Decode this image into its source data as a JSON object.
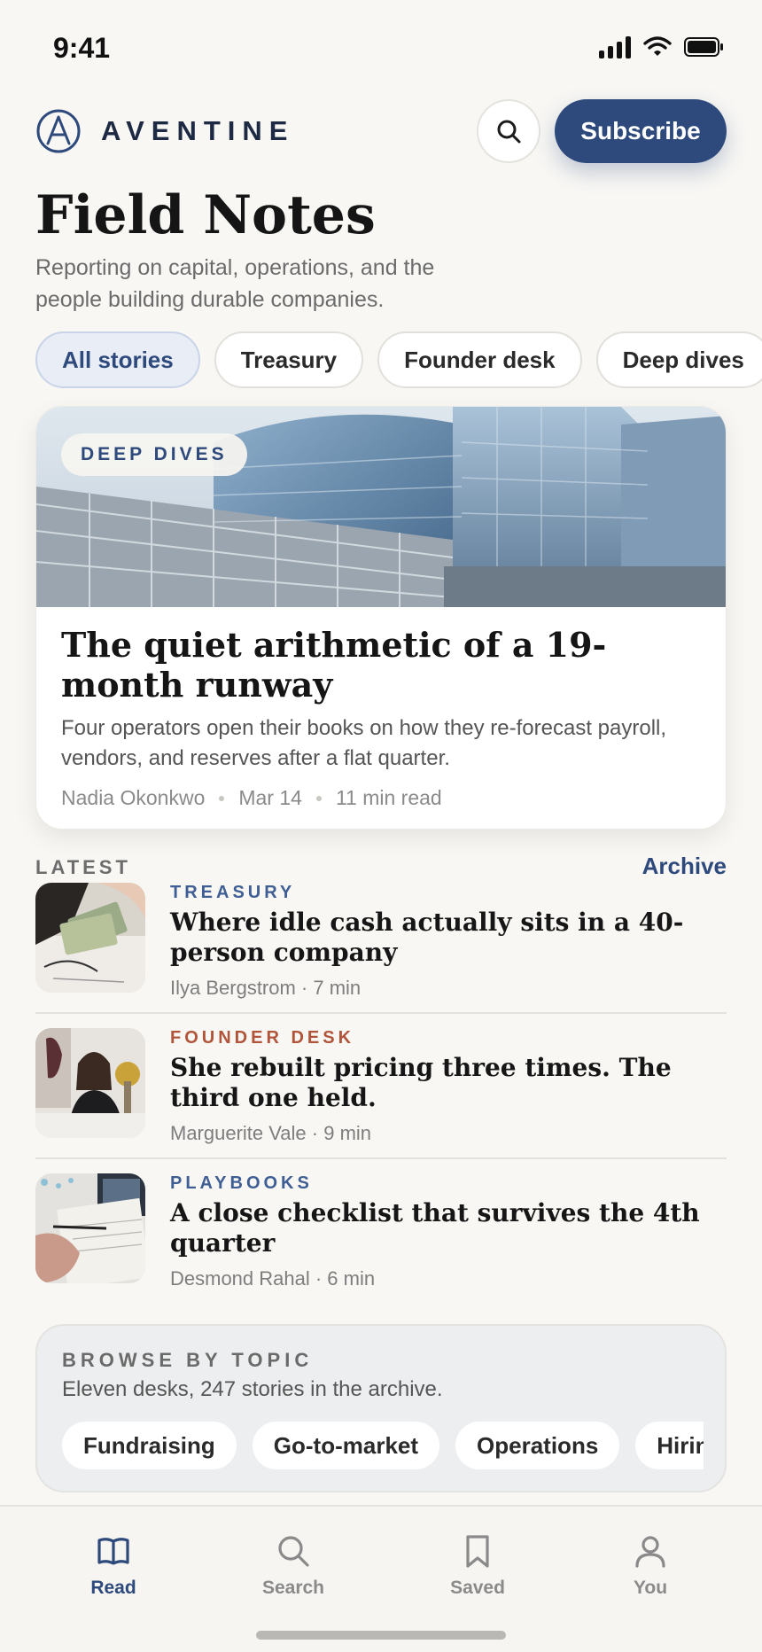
{
  "status_bar": {
    "time": "9:41"
  },
  "header": {
    "brand": "AVENTINE",
    "subscribe_label": "Subscribe"
  },
  "page": {
    "title": "Field Notes",
    "subtitle": "Reporting on capital, operations, and the people building durable companies."
  },
  "filters": [
    {
      "label": "All stories",
      "active": true
    },
    {
      "label": "Treasury",
      "active": false
    },
    {
      "label": "Founder desk",
      "active": false
    },
    {
      "label": "Deep dives",
      "active": false
    }
  ],
  "featured": {
    "badge": "DEEP DIVES",
    "title": "The quiet arithmetic of a 19-month runway",
    "dek": "Four operators open their books on how they re-forecast payroll, vendors, and reserves after a flat quarter.",
    "author": "Nadia Okonkwo",
    "date": "Mar 14",
    "read_time": "11 min read"
  },
  "latest": {
    "label": "LATEST",
    "archive_label": "Archive",
    "items": [
      {
        "kicker": "TREASURY",
        "kicker_color": "#3f5f94",
        "title": "Where idle cash actually sits in a 40-person company",
        "meta": "Ilya Bergstrom · 7 min"
      },
      {
        "kicker": "FOUNDER DESK",
        "kicker_color": "#b0553a",
        "title": "She rebuilt pricing three times. The third one held.",
        "meta": "Marguerite Vale · 9 min"
      },
      {
        "kicker": "PLAYBOOKS",
        "kicker_color": "#3f5f94",
        "title": "A close checklist that survives the 4th quarter",
        "meta": "Desmond Rahal · 6 min"
      }
    ]
  },
  "browse": {
    "label": "BROWSE BY TOPIC",
    "subtitle": "Eleven desks, 247 stories in the archive.",
    "topics": [
      "Fundraising",
      "Go-to-market",
      "Operations",
      "Hiring"
    ]
  },
  "tabbar": {
    "tabs": [
      {
        "label": "Read",
        "icon": "book-icon",
        "active": true
      },
      {
        "label": "Search",
        "icon": "search-icon",
        "active": false
      },
      {
        "label": "Saved",
        "icon": "bookmark-icon",
        "active": false
      },
      {
        "label": "You",
        "icon": "person-icon",
        "active": false
      }
    ]
  },
  "colors": {
    "accent": "#2e4a7c",
    "background": "#f8f7f4"
  }
}
